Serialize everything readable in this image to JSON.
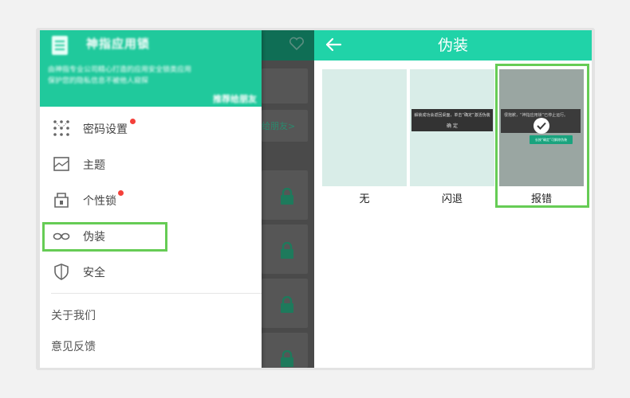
{
  "drawer": {
    "header": {
      "title": "神指应用锁",
      "desc_line1": "由神指专业公司精心打造的应用安全锁类应用",
      "desc_line2": "保护您的隐私信息不被他人窥探",
      "share": "推荐给朋友"
    },
    "items": [
      {
        "label": "密码设置",
        "icon": "pattern-dots-icon",
        "badge": true
      },
      {
        "label": "主题",
        "icon": "picture-frame-icon",
        "badge": false
      },
      {
        "label": "个性锁",
        "icon": "shop-lock-icon",
        "badge": true
      },
      {
        "label": "伪装",
        "icon": "glasses-icon",
        "badge": false
      },
      {
        "label": "安全",
        "icon": "shield-icon",
        "badge": false
      }
    ],
    "footer_items": [
      "关于我们",
      "意见反馈"
    ]
  },
  "background_app": {
    "invite_text": "给朋友>"
  },
  "disguise_screen": {
    "title": "伪装",
    "options": [
      {
        "label": "无",
        "selected": false
      },
      {
        "label": "闪退",
        "selected": false,
        "dialog_text": "解锁成功会返回桌面，单击“确定”激活伪装",
        "dialog_button": "确 定"
      },
      {
        "label": "报错",
        "selected": true,
        "dialog_text": "很抱歉，“神指应用锁”已停止运行。",
        "tip_text": "长按“确定”可解除伪装"
      }
    ]
  },
  "colors": {
    "accent": "#20d3a8",
    "drawer_header": "#20c99c",
    "highlight": "#66cc55",
    "badge": "#f4403a"
  }
}
